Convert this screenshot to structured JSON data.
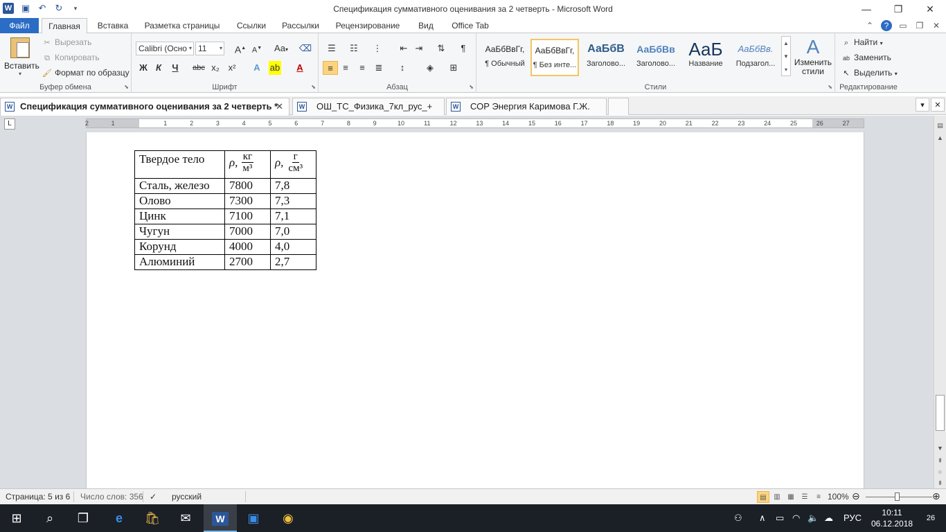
{
  "window": {
    "title": "Спецификация суммативного оценивания за 2 четверть  -  Microsoft Word",
    "app_icon_letter": "W"
  },
  "ribbon_tabs": [
    {
      "label": "Файл"
    },
    {
      "label": "Главная"
    },
    {
      "label": "Вставка"
    },
    {
      "label": "Разметка страницы"
    },
    {
      "label": "Ссылки"
    },
    {
      "label": "Рассылки"
    },
    {
      "label": "Рецензирование"
    },
    {
      "label": "Вид"
    },
    {
      "label": "Office Tab"
    }
  ],
  "clipboard": {
    "paste": "Вставить",
    "cut": "Вырезать",
    "copy": "Копировать",
    "format_painter": "Формат по образцу",
    "label": "Буфер обмена"
  },
  "font": {
    "name": "Calibri (Осно",
    "size": "11",
    "label": "Шрифт",
    "bold": "Ж",
    "italic": "К",
    "underline": "Ч",
    "strike": "abc",
    "sub": "x₂",
    "sup": "x²",
    "aa": "Aa",
    "grow": "A",
    "shrink": "A"
  },
  "paragraph": {
    "label": "Абзац",
    "pilcrow": "¶"
  },
  "styles": {
    "label": "Стили",
    "items": [
      {
        "sample": "АаБбВвГг,",
        "name": "¶ Обычный"
      },
      {
        "sample": "АаБбВвГг,",
        "name": "¶ Без инте..."
      },
      {
        "sample": "АаБбВ",
        "name": "Заголово..."
      },
      {
        "sample": "АаБбВв",
        "name": "Заголово..."
      },
      {
        "sample": "АаБ",
        "name": "Название"
      },
      {
        "sample": "АаБбВв.",
        "name": "Подзагол..."
      }
    ],
    "change": "Изменить стили"
  },
  "editing": {
    "label": "Редактирование",
    "find": "Найти",
    "replace": "Заменить",
    "select": "Выделить"
  },
  "doc_tabs": [
    {
      "label": "Спецификация суммативного оценивания за 2 четверть *"
    },
    {
      "label": "ОШ_ТС_Физика_7кл_рус_+"
    },
    {
      "label": "СОР Энергия Каримова Г.Ж."
    }
  ],
  "ruler_ticks": [
    "2",
    "1",
    "1",
    "2",
    "3",
    "4",
    "5",
    "6",
    "7",
    "8",
    "9",
    "10",
    "11",
    "12",
    "13",
    "14",
    "15",
    "16",
    "17",
    "18",
    "19",
    "20",
    "21",
    "22",
    "23",
    "24",
    "25",
    "26",
    "27"
  ],
  "table": {
    "header": {
      "col1": "Твердое тело",
      "rho": "ρ,",
      "col2_num": "кг",
      "col2_den": "м³",
      "col3_num": "г",
      "col3_den": "см³"
    },
    "rows": [
      {
        "name": "Сталь, железо",
        "kg": "7800",
        "g": "7,8"
      },
      {
        "name": "Олово",
        "kg": "7300",
        "g": "7,3"
      },
      {
        "name": "Цинк",
        "kg": "7100",
        "g": "7,1"
      },
      {
        "name": "Чугун",
        "kg": "7000",
        "g": "7,0"
      },
      {
        "name": "Корунд",
        "kg": "4000",
        "g": "4,0"
      },
      {
        "name": "Алюминий",
        "kg": "2700",
        "g": "2,7"
      }
    ]
  },
  "status": {
    "page": "Страница: 5 из 6",
    "words": "Число слов: 356",
    "language": "русский",
    "zoom": "100%"
  },
  "taskbar": {
    "language": "РУС",
    "time": "10:11",
    "date": "06.12.2018",
    "notifications": "26"
  }
}
